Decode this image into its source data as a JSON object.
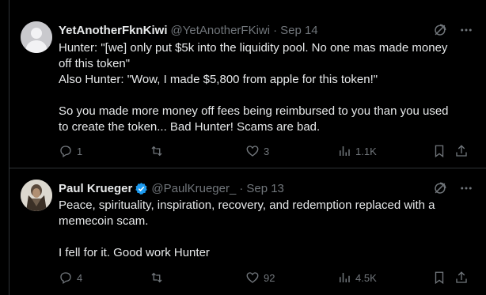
{
  "tweets": [
    {
      "name": "YetAnotherFknKiwi",
      "handle": "@YetAnotherFKiwi",
      "separator": "·",
      "date": "Sep 14",
      "verified": false,
      "body": "Hunter: \"[we] only put $5k into the liquidity pool. No one mas made money\noff this token\"\nAlso Hunter: \"Wow, I made $5,800 from apple for this token!\"\n\nSo you made more money off fees being reimbursed to you than you used\nto create the token... Bad Hunter! Scams are bad.",
      "replies": "1",
      "retweets": "",
      "likes": "3",
      "views": "1.1K"
    },
    {
      "name": "Paul Krueger",
      "handle": "@PaulKrueger_",
      "separator": "·",
      "date": "Sep 13",
      "verified": true,
      "body": "Peace, spirituality, inspiration, recovery, and redemption replaced with a\nmemecoin scam.\n\nI fell for it. Good work Hunter",
      "replies": "4",
      "retweets": "",
      "likes": "92",
      "views": "4.5K"
    }
  ],
  "icons": {
    "grok": "grok-icon",
    "more": "more-icon",
    "reply": "reply-icon",
    "retweet": "retweet-icon",
    "like": "heart-icon",
    "views": "views-icon",
    "bookmark": "bookmark-icon",
    "share": "share-icon",
    "verified": "verified-badge-icon"
  },
  "colors": {
    "background": "#000000",
    "text": "#e7e9ea",
    "muted": "#71767b",
    "divider": "#2f3336",
    "verified": "#1d9bf0"
  }
}
